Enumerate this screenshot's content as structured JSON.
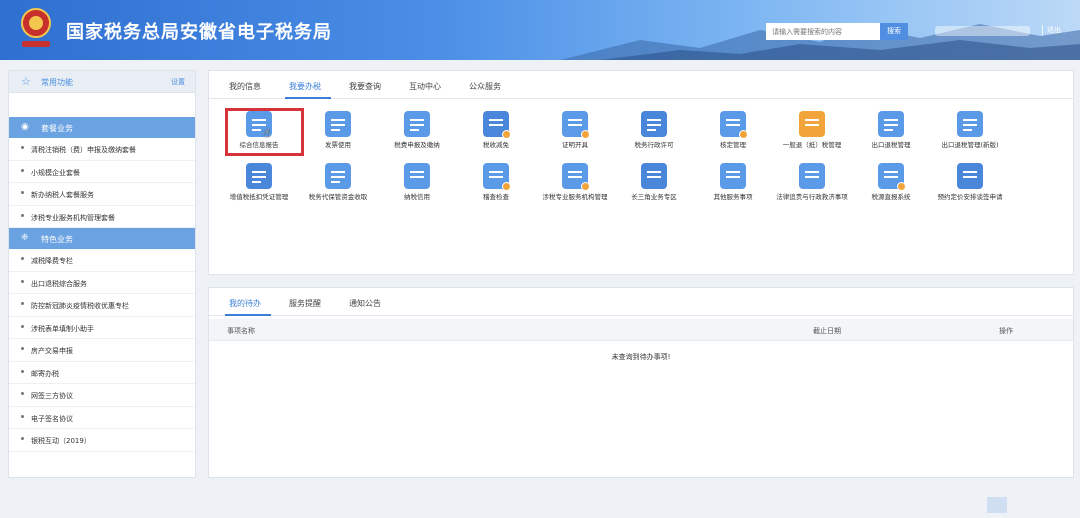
{
  "header": {
    "title": "国家税务总局安徽省电子税务局",
    "search_placeholder": "请输入需要搜索的内容",
    "search_button": "搜索",
    "logout": "退出"
  },
  "sidebar": {
    "common_label": "常用功能",
    "common_setting": "设置",
    "package_section": "套餐业务",
    "package_items": [
      "清税注销税（费）申报及缴纳套餐",
      "小规模企业套餐",
      "新办纳税人套餐服务",
      "涉税专业服务机构管理套餐"
    ],
    "special_section": "特色业务",
    "special_items": [
      "减税降费专栏",
      "出口退税综合服务",
      "防控新冠肺炎疫情税收优惠专栏",
      "涉税表单填制小助手",
      "房产交易申报",
      "邮寄办税",
      "网签三方协议",
      "电子签名协议",
      "银税互动（2019）"
    ]
  },
  "main": {
    "tabs": [
      "我的信息",
      "我要办税",
      "我要查询",
      "互动中心",
      "公众服务"
    ],
    "functions_row1": [
      "综合信息报告",
      "发票使用",
      "税费申报及缴纳",
      "税收减免",
      "证明开具",
      "税务行政许可",
      "核定管理",
      "一般退（抵）税管理",
      "出口退税管理",
      "出口退税管理(新版)"
    ],
    "functions_row2": [
      "增值税抵扣凭证管理",
      "税务代保管资金收取",
      "纳税信用",
      "稽查检查",
      "涉税专业服务机构管理",
      "长三角业务专区",
      "其他服务事项",
      "法律追责与行政救济事项",
      "税源直报系统",
      "预约定价安排谈签申请"
    ]
  },
  "todo": {
    "tabs": [
      "我的待办",
      "服务提醒",
      "通知公告"
    ],
    "col_name": "事项名称",
    "col_deadline": "截止日期",
    "col_action": "操作",
    "empty_message": "未查询到待办事项!"
  },
  "colors": {
    "accent": "#3a7fd8",
    "sidebar_section": "#6aa2e2",
    "highlight": "#d8323a"
  }
}
